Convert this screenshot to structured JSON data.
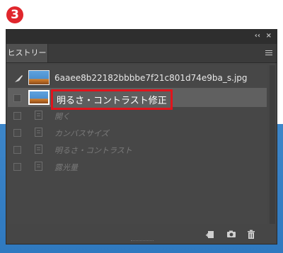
{
  "step_badge": "3",
  "panel": {
    "collapse_glyph": "‹‹",
    "close_glyph": "×",
    "tab_label": "ヒストリー",
    "menu_icon": "hamburger-icon"
  },
  "history": {
    "snapshot": {
      "label": "6aaee8b22182bbbbe7f21c801d74e9ba_s.jpg"
    },
    "selected": {
      "label": "明るさ・コントラスト修正"
    },
    "states": [
      {
        "label": "開く"
      },
      {
        "label": "カンバスサイズ"
      },
      {
        "label": "明るさ・コントラスト"
      },
      {
        "label": "露光量"
      }
    ]
  },
  "footer": {
    "new_document_icon": "new-document-from-state-icon",
    "snapshot_icon": "camera-icon",
    "delete_icon": "trash-icon"
  },
  "colors": {
    "badge": "#e0262c",
    "highlight_border": "#e0141c",
    "panel_bg": "#464646",
    "selected_row": "#606060"
  }
}
